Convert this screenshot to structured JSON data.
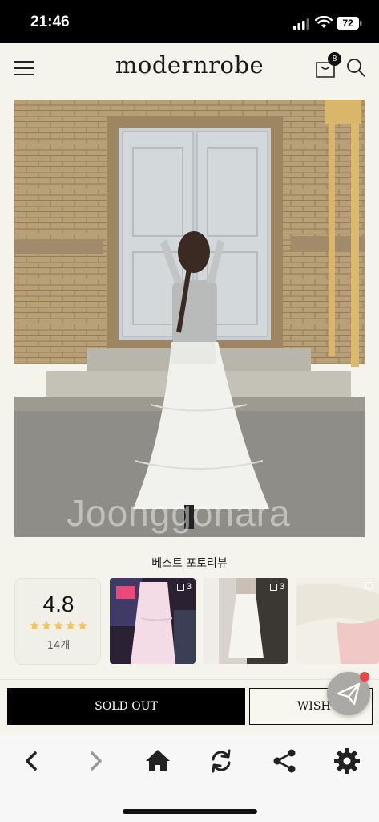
{
  "status_bar": {
    "time": "21:46",
    "battery": "72"
  },
  "header": {
    "brand": "modernrobe",
    "cart_count": "8"
  },
  "product": {
    "watermark": "Joonggonara"
  },
  "reviews": {
    "title": "베스트 포토리뷰",
    "rating": "4.8",
    "stars": 5,
    "count_label": "14개",
    "thumbnails": [
      {
        "count": "3"
      },
      {
        "count": "3"
      },
      {
        "count": ""
      }
    ]
  },
  "actions": {
    "soldout_label": "SOLD OUT",
    "wish_label": "WISH"
  },
  "colors": {
    "accent": "#000000",
    "background": "#f4f3ec",
    "notification": "#ef4444",
    "star": "#f5c453"
  },
  "browser_nav": {
    "icons": [
      "back-icon",
      "forward-icon",
      "home-icon",
      "refresh-icon",
      "share-icon",
      "settings-icon"
    ]
  }
}
